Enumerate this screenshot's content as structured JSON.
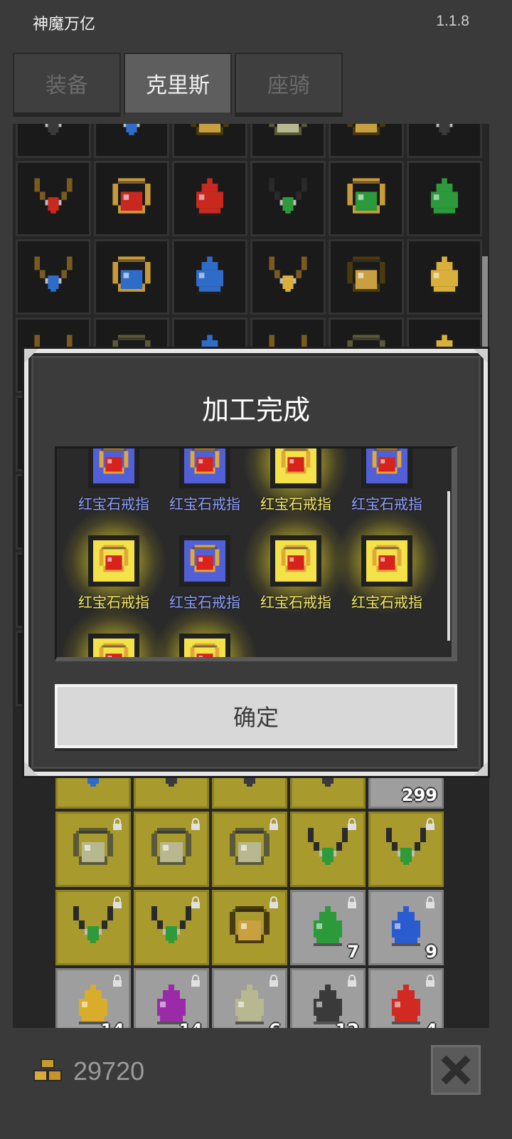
{
  "header": {
    "app_title": "神魔万亿",
    "version": "1.1.8"
  },
  "tabs": [
    {
      "label": "装备",
      "active": false
    },
    {
      "label": "克里斯",
      "active": true
    },
    {
      "label": "座骑",
      "active": false
    }
  ],
  "inventory": {
    "counts": [
      "299",
      "7",
      "9",
      "14",
      "14",
      "6",
      "12",
      "4"
    ]
  },
  "bottom": {
    "gold_amount": "29720"
  },
  "dialog": {
    "title": "加工完成",
    "confirm_label": "确定",
    "items": [
      {
        "name": "红宝石戒指",
        "rarity": "blue"
      },
      {
        "name": "红宝石戒指",
        "rarity": "blue"
      },
      {
        "name": "红宝石戒指",
        "rarity": "gold"
      },
      {
        "name": "红宝石戒指",
        "rarity": "blue"
      },
      {
        "name": "红宝石戒指",
        "rarity": "gold"
      },
      {
        "name": "红宝石戒指",
        "rarity": "blue"
      },
      {
        "name": "红宝石戒指",
        "rarity": "gold"
      },
      {
        "name": "红宝石戒指",
        "rarity": "gold"
      },
      {
        "name": "",
        "rarity": "gold"
      },
      {
        "name": "",
        "rarity": "gold"
      }
    ]
  },
  "colors": {
    "gold_item": "#f4e24a",
    "blue_item": "#5260d8",
    "ruby": "#d8231c",
    "ring_gold": "#e0a838"
  }
}
